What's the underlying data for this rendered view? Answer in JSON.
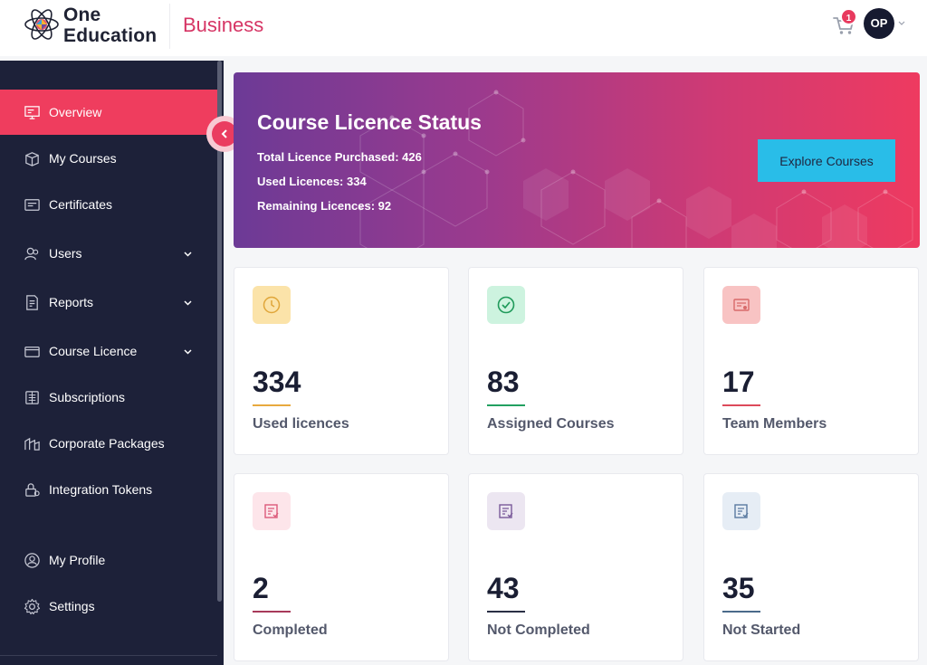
{
  "header": {
    "logo_line1": "One",
    "logo_line2": "Education",
    "brand_sub": "Business",
    "cart_count": "1",
    "avatar_initials": "OP"
  },
  "sidebar": {
    "items": [
      {
        "label": "Overview",
        "icon": "overview-icon",
        "active": true
      },
      {
        "label": "My Courses",
        "icon": "courses-icon"
      },
      {
        "label": "Certificates",
        "icon": "certificate-icon"
      },
      {
        "label": "Users",
        "icon": "users-icon",
        "expandable": true
      },
      {
        "label": "Reports",
        "icon": "reports-icon",
        "expandable": true
      },
      {
        "label": "Course Licence",
        "icon": "licence-icon",
        "expandable": true
      },
      {
        "label": "Subscriptions",
        "icon": "subscriptions-icon"
      },
      {
        "label": "Corporate Packages",
        "icon": "packages-icon"
      },
      {
        "label": "Integration Tokens",
        "icon": "lock-icon"
      },
      {
        "label": "My Profile",
        "icon": "profile-icon"
      },
      {
        "label": "Settings",
        "icon": "gear-icon"
      }
    ]
  },
  "banner": {
    "title": "Course Licence Status",
    "total": "Total Licence Purchased: 426",
    "used": "Used Licences: 334",
    "remaining": "Remaining Licences: 92",
    "button": "Explore Courses"
  },
  "cards": [
    {
      "value": "334",
      "label": "Used licences",
      "icon": "clock-icon",
      "icon_bg": "#fbe3a9",
      "icon_color": "#e0a63a",
      "accent": "#e8a93e"
    },
    {
      "value": "83",
      "label": "Assigned Courses",
      "icon": "check-circle-icon",
      "icon_bg": "#cdf3df",
      "icon_color": "#1f9a5a",
      "accent": "#22a060"
    },
    {
      "value": "17",
      "label": "Team Members",
      "icon": "certificate-icon",
      "icon_bg": "#f8c3c3",
      "icon_color": "#d86a6a",
      "accent": "#dd4a5a"
    },
    {
      "value": "2",
      "label": "Completed",
      "icon": "report-icon",
      "icon_bg": "#fde5ea",
      "icon_color": "#dc5a7a",
      "accent": "#a83a5a"
    },
    {
      "value": "43",
      "label": "Not Completed",
      "icon": "report-icon",
      "icon_bg": "#ece6f1",
      "icon_color": "#7a5a9a",
      "accent": "#2a2f45"
    },
    {
      "value": "35",
      "label": "Not Started",
      "icon": "report-icon",
      "icon_bg": "#e6edf5",
      "icon_color": "#5a7aa0",
      "accent": "#4a6a8a"
    }
  ]
}
